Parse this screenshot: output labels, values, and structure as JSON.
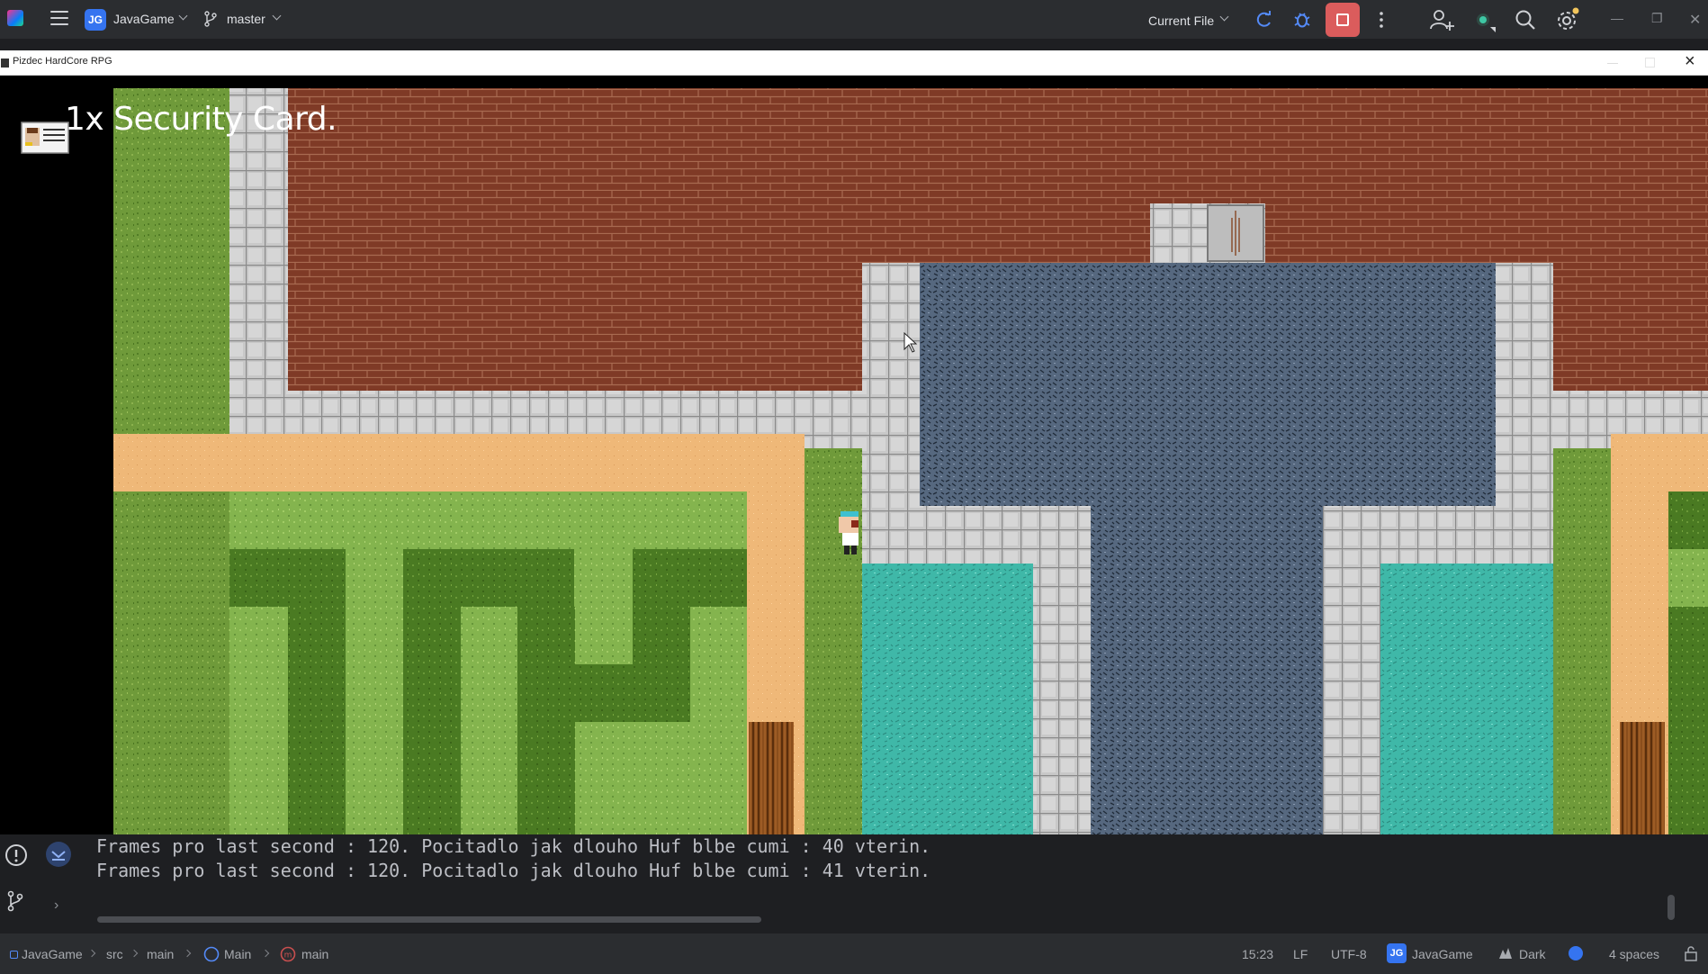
{
  "toolbar": {
    "project_badge": "JG",
    "project_name": "JavaGame",
    "branch": "master",
    "run_config": "Current File"
  },
  "game_window": {
    "title": "Pizdec HardCore RPG",
    "hud_message": "1x Security Card."
  },
  "console": {
    "lines": [
      "Frames pro last second : 120. Pocitadlo jak dlouho Huf blbe cumi : 40 vterin.",
      "Frames pro last second : 120. Pocitadlo jak dlouho Huf blbe cumi : 41 vterin."
    ]
  },
  "statusbar": {
    "breadcrumb": [
      "JavaGame",
      "src",
      "main",
      "Main",
      "main"
    ],
    "position": "15:23",
    "line_ending": "LF",
    "encoding": "UTF-8",
    "project_badge": "JG",
    "project_name": "JavaGame",
    "theme": "Dark",
    "indent": "4 spaces"
  },
  "colors": {
    "accent": "#3574f0",
    "stop": "#db5c5c",
    "brick": "#7f3a26",
    "grass": "#6f9a3a",
    "grass_dark": "#4a7a22",
    "sand": "#f0b878",
    "water": "#3fb8a8",
    "stone": "#54667e",
    "tile": "#c9c9c9"
  }
}
